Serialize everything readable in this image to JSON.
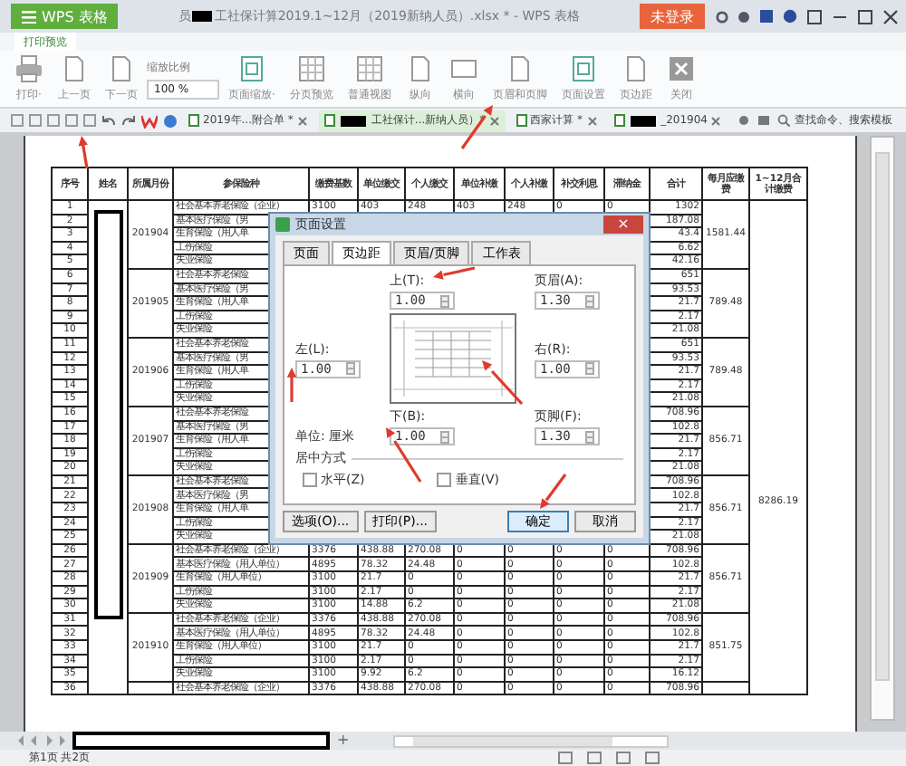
{
  "titlebar": {
    "menu_button": "WPS 表格",
    "title_start": "员",
    "title_end": "工社保计算2019.1~12月（2019新纳人员）.xlsx * - WPS 表格",
    "login_button": "未登录"
  },
  "ribbon_tab": "打印预览",
  "ribbon": [
    {
      "kind": "printer",
      "label": "打印·"
    },
    {
      "kind": "page",
      "label": "上一页"
    },
    {
      "kind": "page",
      "label": "下一页"
    },
    {
      "kind": "zoom",
      "label": "缩放比例",
      "value": "100 %"
    },
    {
      "kind": "fit",
      "label": "页面缩放·"
    },
    {
      "kind": "grid",
      "label": "分页预览"
    },
    {
      "kind": "grid",
      "label": "普通视图"
    },
    {
      "kind": "page",
      "label": "纵向"
    },
    {
      "kind": "landscape",
      "label": "横向"
    },
    {
      "kind": "page",
      "label": "页眉和页脚"
    },
    {
      "kind": "fit",
      "label": "页面设置"
    },
    {
      "kind": "page",
      "label": "页边距"
    },
    {
      "kind": "close",
      "label": "关闭"
    }
  ],
  "doc_tabs": [
    {
      "label": "2019年...附合单 *",
      "redacted": false,
      "selected": false
    },
    {
      "label": "工社保计...新纳人员）*",
      "redacted": true,
      "selected": true
    },
    {
      "label": "西家计算 *",
      "redacted": false,
      "selected": false
    },
    {
      "label": "_201904",
      "redacted": true,
      "selected": false
    }
  ],
  "search": {
    "placeholder": "查找命令、搜索模板"
  },
  "table": {
    "columns": [
      "序号",
      "姓名",
      "所属月份",
      "参保险种",
      "缴费基数",
      "单位缴交",
      "个人缴交",
      "单位补缴",
      "个人补缴",
      "补交利息",
      "滞纳金",
      "合计",
      "每月应缴费",
      "1~12月合计缴费"
    ],
    "grand_total": "8286.19",
    "groups": [
      {
        "month": "201904",
        "monthly": "1581.44",
        "rows": [
          {
            "no": "1",
            "insurance": "社会基本养老保险（企业）",
            "base": "3100",
            "unit": "403",
            "personal": "248",
            "unit_back": "403",
            "personal_back": "248",
            "interest": "0",
            "late_fee": "0",
            "total": "1302"
          },
          {
            "no": "2",
            "insurance": "基本医疗保险（男",
            "total": "187.08"
          },
          {
            "no": "3",
            "insurance": "生育保险（用人单",
            "total": "43.4"
          },
          {
            "no": "4",
            "insurance": "工伤保险",
            "total": "6.62"
          },
          {
            "no": "5",
            "insurance": "失业保险",
            "total": "42.16"
          }
        ]
      },
      {
        "month": "201905",
        "monthly": "789.48",
        "rows": [
          {
            "no": "6",
            "insurance": "社会基本养老保险",
            "total": "651"
          },
          {
            "no": "7",
            "insurance": "基本医疗保险（男",
            "total": "93.53"
          },
          {
            "no": "8",
            "insurance": "生育保险（用人单",
            "total": "21.7"
          },
          {
            "no": "9",
            "insurance": "工伤保险",
            "total": "2.17"
          },
          {
            "no": "10",
            "insurance": "失业保险",
            "total": "21.08"
          }
        ]
      },
      {
        "month": "201906",
        "monthly": "789.48",
        "rows": [
          {
            "no": "11",
            "insurance": "社会基本养老保险",
            "total": "651"
          },
          {
            "no": "12",
            "insurance": "基本医疗保险（男",
            "total": "93.53"
          },
          {
            "no": "13",
            "insurance": "生育保险（用人单",
            "total": "21.7"
          },
          {
            "no": "14",
            "insurance": "工伤保险",
            "total": "2.17"
          },
          {
            "no": "15",
            "insurance": "失业保险",
            "total": "21.08"
          }
        ]
      },
      {
        "month": "201907",
        "monthly": "856.71",
        "rows": [
          {
            "no": "16",
            "insurance": "社会基本养老保险",
            "total": "708.96"
          },
          {
            "no": "17",
            "insurance": "基本医疗保险（男",
            "total": "102.8"
          },
          {
            "no": "18",
            "insurance": "生育保险（用人单",
            "total": "21.7"
          },
          {
            "no": "19",
            "insurance": "工伤保险",
            "total": "2.17"
          },
          {
            "no": "20",
            "insurance": "失业保险",
            "total": "21.08"
          }
        ]
      },
      {
        "month": "201908",
        "monthly": "856.71",
        "rows": [
          {
            "no": "21",
            "insurance": "社会基本养老保险",
            "total": "708.96"
          },
          {
            "no": "22",
            "insurance": "基本医疗保险（男",
            "total": "102.8"
          },
          {
            "no": "23",
            "insurance": "生育保险（用人单",
            "total": "21.7"
          },
          {
            "no": "24",
            "insurance": "工伤保险",
            "total": "2.17"
          },
          {
            "no": "25",
            "insurance": "失业保险",
            "total": "21.08"
          }
        ]
      },
      {
        "month": "201909",
        "monthly": "856.71",
        "rows": [
          {
            "no": "26",
            "insurance": "社会基本养老保险（企业）",
            "base": "3376",
            "unit": "438.88",
            "personal": "270.08",
            "unit_back": "0",
            "personal_back": "0",
            "interest": "0",
            "late_fee": "0",
            "total": "708.96"
          },
          {
            "no": "27",
            "insurance": "基本医疗保险（用人单位）",
            "base": "4895",
            "unit": "78.32",
            "personal": "24.48",
            "unit_back": "0",
            "personal_back": "0",
            "interest": "0",
            "late_fee": "0",
            "total": "102.8"
          },
          {
            "no": "28",
            "insurance": "生育保险（用人单位）",
            "base": "3100",
            "unit": "21.7",
            "personal": "0",
            "unit_back": "0",
            "personal_back": "0",
            "interest": "0",
            "late_fee": "0",
            "total": "21.7"
          },
          {
            "no": "29",
            "insurance": "工伤保险",
            "base": "3100",
            "unit": "2.17",
            "personal": "0",
            "unit_back": "0",
            "personal_back": "0",
            "interest": "0",
            "late_fee": "0",
            "total": "2.17"
          },
          {
            "no": "30",
            "insurance": "失业保险",
            "base": "3100",
            "unit": "14.88",
            "personal": "6.2",
            "unit_back": "0",
            "personal_back": "0",
            "interest": "0",
            "late_fee": "0",
            "total": "21.08"
          }
        ]
      },
      {
        "month": "201910",
        "monthly": "851.75",
        "rows": [
          {
            "no": "31",
            "insurance": "社会基本养老保险（企业）",
            "base": "3376",
            "unit": "438.88",
            "personal": "270.08",
            "unit_back": "0",
            "personal_back": "0",
            "interest": "0",
            "late_fee": "0",
            "total": "708.96"
          },
          {
            "no": "32",
            "insurance": "基本医疗保险（用人单位）",
            "base": "4895",
            "unit": "78.32",
            "personal": "24.48",
            "unit_back": "0",
            "personal_back": "0",
            "interest": "0",
            "late_fee": "0",
            "total": "102.8"
          },
          {
            "no": "33",
            "insurance": "生育保险（用人单位）",
            "base": "3100",
            "unit": "21.7",
            "personal": "0",
            "unit_back": "0",
            "personal_back": "0",
            "interest": "0",
            "late_fee": "0",
            "total": "21.7"
          },
          {
            "no": "34",
            "insurance": "工伤保险",
            "base": "3100",
            "unit": "2.17",
            "personal": "0",
            "unit_back": "0",
            "personal_back": "0",
            "interest": "0",
            "late_fee": "0",
            "total": "2.17"
          },
          {
            "no": "35",
            "insurance": "失业保险",
            "base": "3100",
            "unit": "9.92",
            "personal": "6.2",
            "unit_back": "0",
            "personal_back": "0",
            "interest": "0",
            "late_fee": "0",
            "total": "16.12"
          }
        ]
      },
      {
        "rows": [
          {
            "no": "36",
            "insurance": "社会基本养老保险（企业）",
            "base": "3376",
            "unit": "438.88",
            "personal": "270.08",
            "unit_back": "0",
            "personal_back": "0",
            "interest": "0",
            "late_fee": "0",
            "total": "708.96"
          }
        ]
      }
    ]
  },
  "dialog": {
    "title": "页面设置",
    "close": "×",
    "tabs": [
      {
        "label": "页面",
        "selected": false
      },
      {
        "label": "页边距",
        "selected": true
      },
      {
        "label": "页眉/页脚",
        "selected": false
      },
      {
        "label": "工作表",
        "selected": false
      }
    ],
    "fields": [
      {
        "label": "上(T):",
        "value": "1.00"
      },
      {
        "label": "页眉(A):",
        "value": "1.30"
      },
      {
        "label": "左(L):",
        "value": "1.00"
      },
      {
        "label": "右(R):",
        "value": "1.00"
      },
      {
        "label": "下(B):",
        "value": "1.00"
      },
      {
        "label": "页脚(F):",
        "value": "1.30"
      }
    ],
    "unit": "单位: 厘米",
    "center_title": "居中方式",
    "checkboxes": [
      {
        "label": "水平(Z)",
        "checked": false
      },
      {
        "label": "垂直(V)",
        "checked": false
      }
    ],
    "left_buttons": [
      {
        "label": "选项(O)...",
        "default": false
      },
      {
        "label": "打印(P)...",
        "default": false
      }
    ],
    "right_buttons": [
      {
        "label": "确定",
        "default": true
      },
      {
        "label": "取消",
        "default": false
      }
    ]
  },
  "sheet_bar": {
    "add": "+"
  },
  "status_bar": {
    "page": "第1页 共2页"
  }
}
